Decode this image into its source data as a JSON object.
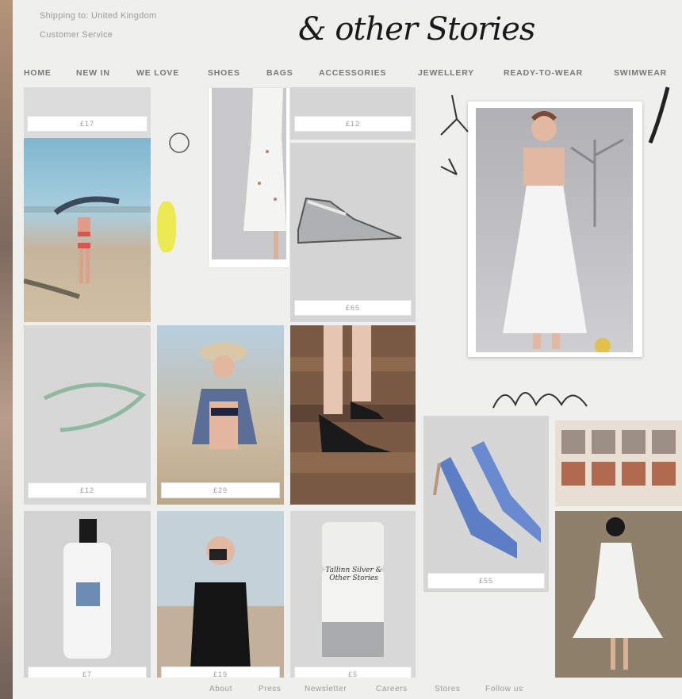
{
  "header": {
    "shipping_text": "Shipping to: United Kingdom",
    "service_text": "Customer Service",
    "logo_text": "& other Stories"
  },
  "nav": {
    "items": [
      "HOME",
      "NEW IN",
      "WE LOVE",
      "SHOES",
      "BAGS",
      "ACCESSORIES",
      "JEWELLERY",
      "READY-TO-WEAR",
      "SWIMWEAR"
    ]
  },
  "products": {
    "price_1": "£17",
    "price_2": "£12",
    "price_3": "£65",
    "price_4": "£12",
    "price_5": "£29",
    "price_6": "£55",
    "price_7": "£7",
    "price_8": "£19",
    "price_9": "£5",
    "lotion_label": "",
    "polish_label": "Tallinn Silver & Other Stories"
  },
  "footer": {
    "items": [
      "About",
      "Press",
      "Newsletter",
      "Careers",
      "Stores",
      "Follow us"
    ]
  },
  "colors": {
    "page_bg": "#efefed",
    "tile_grey": "#d9d9d9",
    "accent_yellow": "#e8e54a",
    "shoe_blue": "#5c7ec4"
  }
}
